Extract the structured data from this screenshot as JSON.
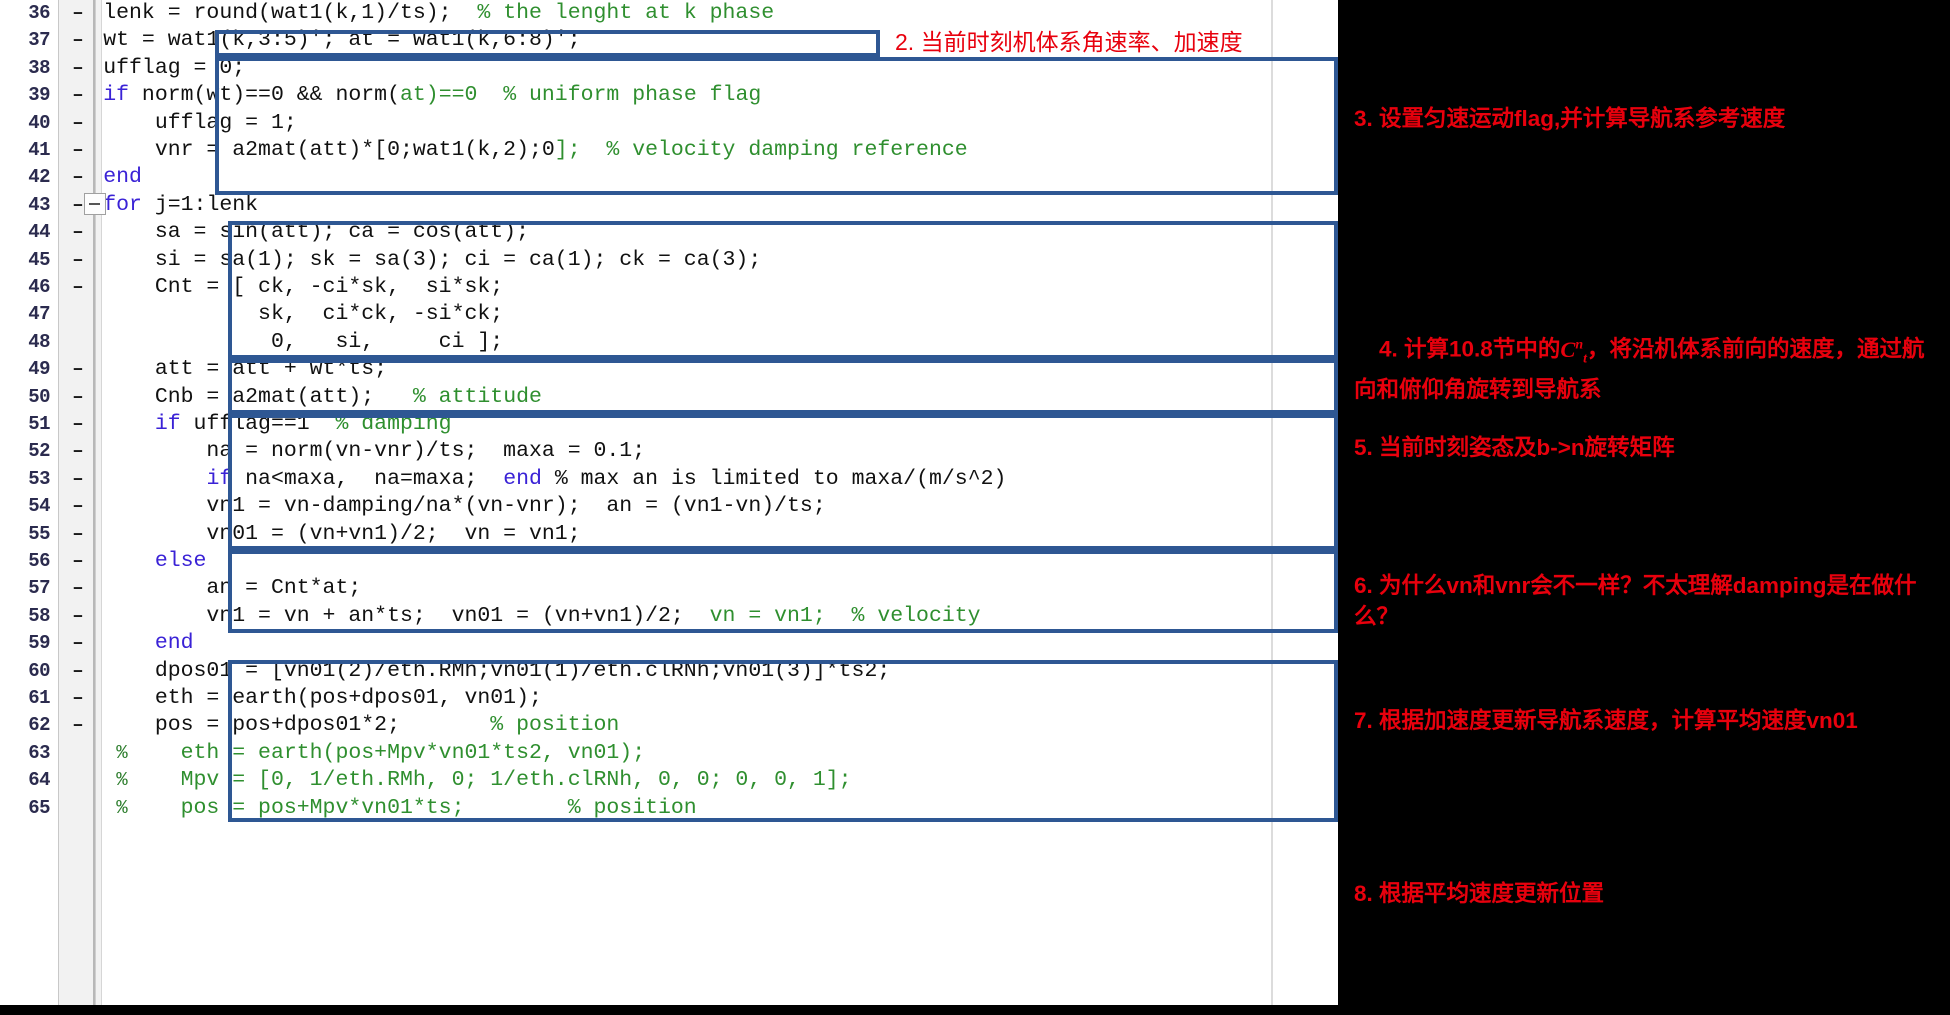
{
  "editor": {
    "language": "MATLAB",
    "first_line_number": 36,
    "lines": [
      {
        "num": "36",
        "dash": "–",
        "pct": "",
        "code": "        lenk = round(wat1(k,1)/ts);  % the lenght at k phase",
        "comment_from": 37
      },
      {
        "num": "37",
        "dash": "–",
        "pct": "",
        "code": "        wt = wat1(k,3:5)'; at = wat1(k,6:8)';"
      },
      {
        "num": "38",
        "dash": "–",
        "pct": "",
        "code": "        ufflag = 0;"
      },
      {
        "num": "39",
        "dash": "–",
        "pct": "",
        "code": "        if norm(wt)==0 && norm(at)==0  % uniform phase flag",
        "kw": "if",
        "comment_from": 31
      },
      {
        "num": "40",
        "dash": "–",
        "pct": "",
        "code": "            ufflag = 1;"
      },
      {
        "num": "41",
        "dash": "–",
        "pct": "",
        "code": "            vnr = a2mat(att)*[0;wat1(k,2);0];  % velocity damping reference",
        "comment_from": 43
      },
      {
        "num": "42",
        "dash": "–",
        "pct": "",
        "code": "        end",
        "kw": "end"
      },
      {
        "num": "43",
        "dash": "–",
        "pct": "",
        "code": "        for j=1:lenk",
        "kw": "for"
      },
      {
        "num": "44",
        "dash": "–",
        "pct": "",
        "code": "            sa = sin(att); ca = cos(att);"
      },
      {
        "num": "45",
        "dash": "–",
        "pct": "",
        "code": "            si = sa(1); sk = sa(3); ci = ca(1); ck = ca(3);"
      },
      {
        "num": "46",
        "dash": "–",
        "pct": "",
        "code": "            Cnt = [ ck, -ci*sk,  si*sk;"
      },
      {
        "num": "47",
        "dash": "",
        "pct": "",
        "code": "                    sk,  ci*ck, -si*ck;"
      },
      {
        "num": "48",
        "dash": "",
        "pct": "",
        "code": "                     0,   si,     ci ];"
      },
      {
        "num": "49",
        "dash": "–",
        "pct": "",
        "code": "            att = att + wt*ts;"
      },
      {
        "num": "50",
        "dash": "–",
        "pct": "",
        "code": "            Cnb = a2mat(att);   % attitude",
        "comment_from": 32
      },
      {
        "num": "51",
        "dash": "–",
        "pct": "",
        "code": "            if ufflag==1  % damping",
        "kw": "if",
        "comment_from": 26
      },
      {
        "num": "52",
        "dash": "–",
        "pct": "",
        "code": "                na = norm(vn-vnr)/ts;  maxa = 0.1;"
      },
      {
        "num": "53",
        "dash": "–",
        "pct": "",
        "code": "                if na<maxa,  na=maxa;  end % max an is limited to maxa/(m/s^2)"
      },
      {
        "num": "54",
        "dash": "–",
        "pct": "",
        "code": "                vn1 = vn-damping/na*(vn-vnr);  an = (vn1-vn)/ts;"
      },
      {
        "num": "55",
        "dash": "–",
        "pct": "",
        "code": "                vn01 = (vn+vn1)/2;  vn = vn1;"
      },
      {
        "num": "56",
        "dash": "–",
        "pct": "",
        "code": "            else",
        "kw": "else"
      },
      {
        "num": "57",
        "dash": "–",
        "pct": "",
        "code": "                an = Cnt*at;"
      },
      {
        "num": "58",
        "dash": "–",
        "pct": "",
        "code": "                vn1 = vn + an*ts;  vn01 = (vn+vn1)/2;  vn = vn1;  % velocity",
        "comment_from": 54
      },
      {
        "num": "59",
        "dash": "–",
        "pct": "",
        "code": "            end",
        "kw": "end"
      },
      {
        "num": "60",
        "dash": "–",
        "pct": "",
        "code": "            dpos01 = [vn01(2)/eth.RMh;vn01(1)/eth.clRNh;vn01(3)]*ts2;"
      },
      {
        "num": "61",
        "dash": "–",
        "pct": "",
        "code": "            eth = earth(pos+dpos01, vn01);"
      },
      {
        "num": "62",
        "dash": "–",
        "pct": "",
        "code": "            pos = pos+dpos01*2;       % position",
        "comment_from": 34
      },
      {
        "num": "63",
        "dash": "",
        "pct": "%",
        "code": "              eth = earth(pos+Mpv*vn01*ts2, vn01);",
        "all_comment": true
      },
      {
        "num": "64",
        "dash": "",
        "pct": "%",
        "code": "              Mpv = [0, 1/eth.RMh, 0; 1/eth.clRNh, 0, 0; 0, 0, 1];",
        "all_comment": true
      },
      {
        "num": "65",
        "dash": "",
        "pct": "%",
        "code": "              pos = pos+Mpv*vn01*ts;        % position",
        "all_comment": true
      }
    ],
    "fold_marker": {
      "line": "43",
      "state": "expanded",
      "glyph": "−"
    }
  },
  "highlight_boxes": [
    {
      "id": "box-1",
      "lines": "37",
      "color": "#2e5793"
    },
    {
      "id": "box-2",
      "lines": "38-42",
      "color": "#2e5793"
    },
    {
      "id": "box-3",
      "lines": "44-48",
      "color": "#2e5793"
    },
    {
      "id": "box-4",
      "lines": "49-50",
      "color": "#2e5793"
    },
    {
      "id": "box-5",
      "lines": "51-55",
      "color": "#2e5793"
    },
    {
      "id": "box-6",
      "lines": "56-58",
      "color": "#2e5793"
    },
    {
      "id": "box-7",
      "lines": "60-65",
      "color": "#2e5793"
    }
  ],
  "annotations": {
    "accent_color": "#e8000d",
    "panel_background": "#000000",
    "inline": {
      "id": "2",
      "text": "2. 当前时刻机体系角速率、加速度"
    },
    "items": [
      {
        "id": "3",
        "text": "3. 设置匀速运动flag,并计算导航系参考速度"
      },
      {
        "id": "4",
        "text_before": "4. 计算10.8节中的",
        "math": {
          "base": "C",
          "sup": "n",
          "sub": "t"
        },
        "text_after": "，将沿机体系前向的速度，通过航向和俯仰角旋转到导航系"
      },
      {
        "id": "5",
        "text": "5. 当前时刻姿态及b->n旋转矩阵"
      },
      {
        "id": "6",
        "text": "6. 为什么vn和vnr会不一样？不太理解damping是在做什么？"
      },
      {
        "id": "7",
        "text": "7. 根据加速度更新导航系速度，计算平均速度vn01"
      },
      {
        "id": "8",
        "text": "8. 根据平均速度更新位置"
      }
    ]
  },
  "colors": {
    "keyword": "#3a22d6",
    "comment": "#2f8f2f",
    "code_text": "#111111",
    "line_number": "#2b2b4e",
    "box_border": "#2e5793",
    "annotation_red": "#e8000d",
    "gutter_background": "#f2f2f2",
    "editor_background": "#ffffff"
  }
}
